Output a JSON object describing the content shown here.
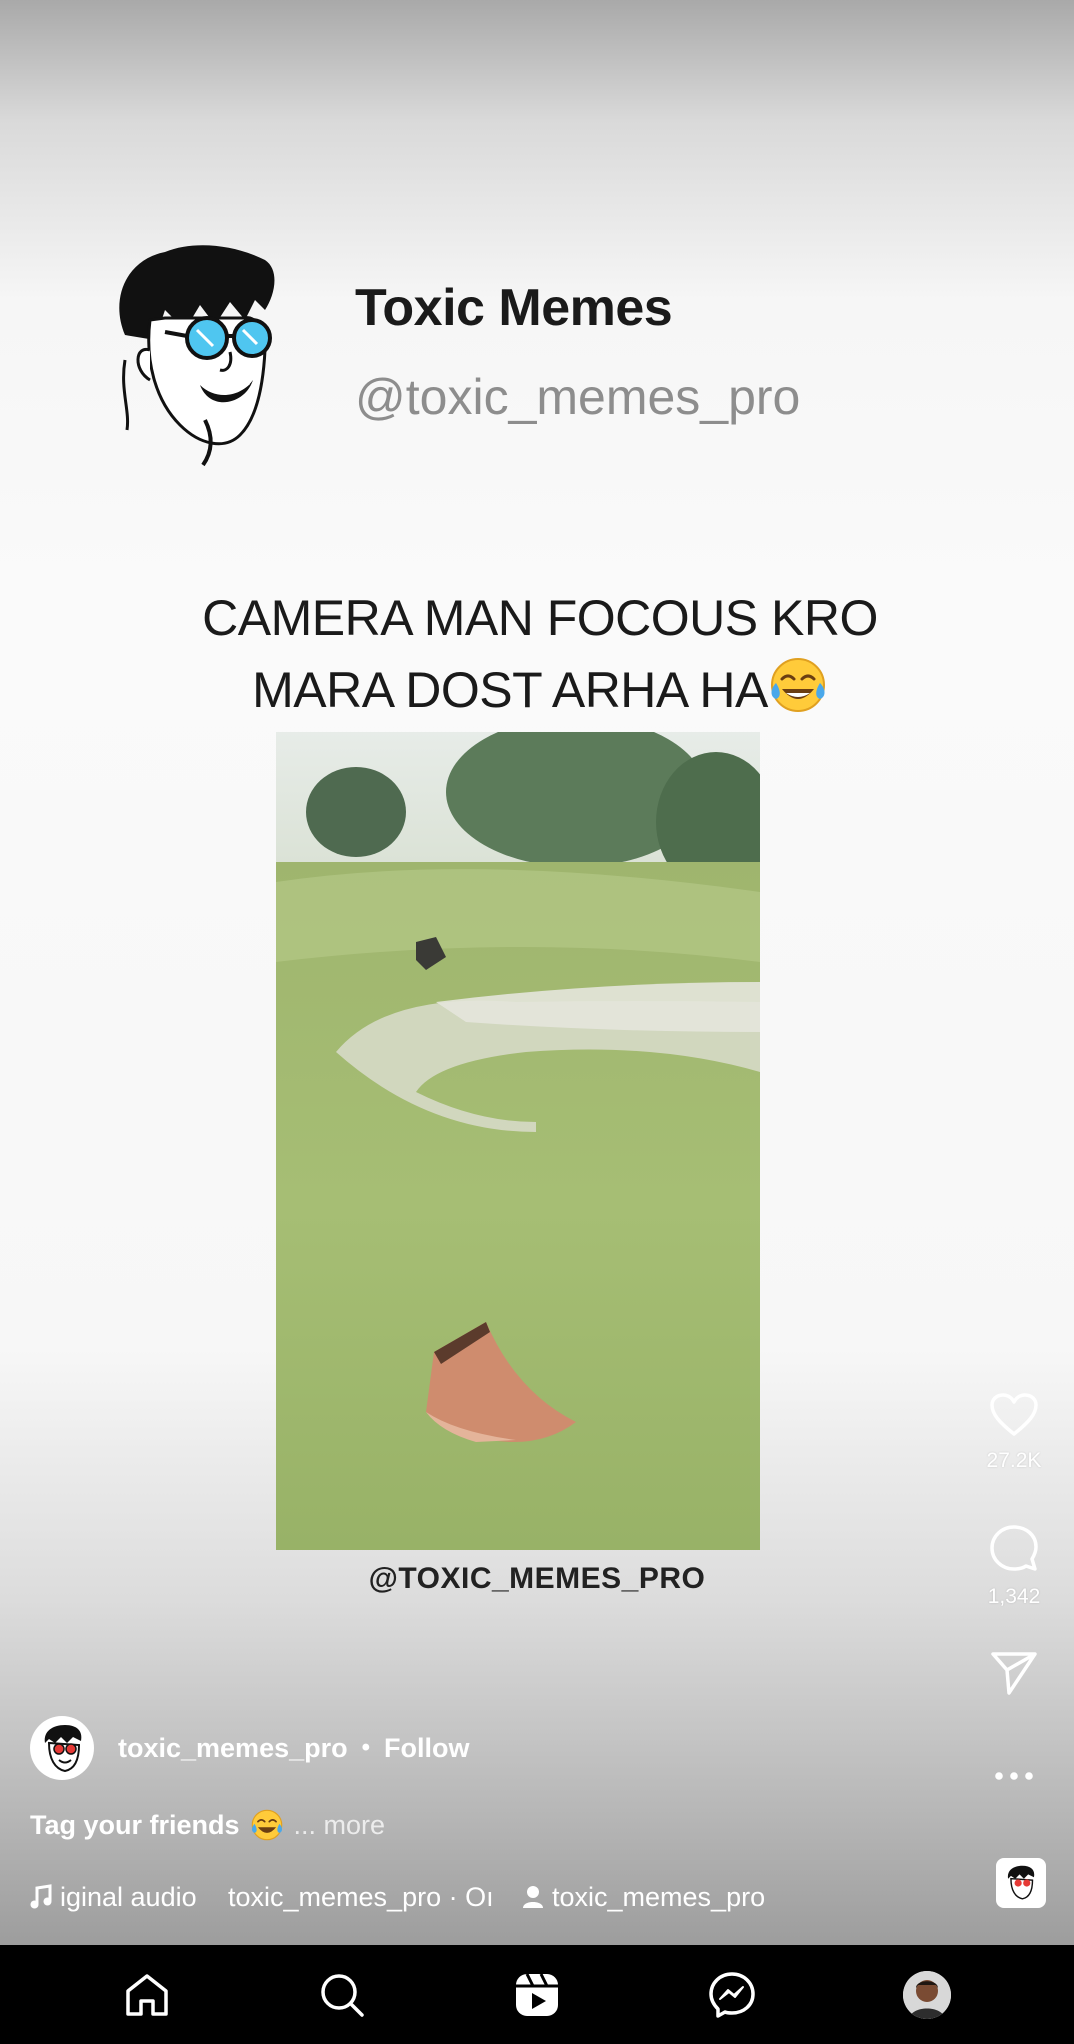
{
  "meme": {
    "title": "Toxic Memes",
    "handle": "@toxic_memes_pro",
    "caption_line1": "CAMERA MAN FOCOUS KRO",
    "caption_line2": "MARA DOST ARHA HA",
    "watermark": "@TOXIC_MEMES_PRO"
  },
  "actions": {
    "likes": "27.2K",
    "comments": "1,342"
  },
  "post": {
    "author": "toxic_memes_pro",
    "separator": "•",
    "follow_label": "Follow",
    "caption": "Tag your friends",
    "more_label": "... more",
    "audio_title": "iginal audio",
    "audio_source": "toxic_memes_pro · Oı",
    "tagged_user": "toxic_memes_pro"
  },
  "icons": {
    "like": "heart-icon",
    "comment": "comment-icon",
    "share": "send-icon",
    "more": "more-dots-icon",
    "music": "music-note-icon",
    "person": "person-icon",
    "home": "home-icon",
    "search": "search-icon",
    "reels": "reels-icon",
    "messenger": "messenger-icon"
  }
}
